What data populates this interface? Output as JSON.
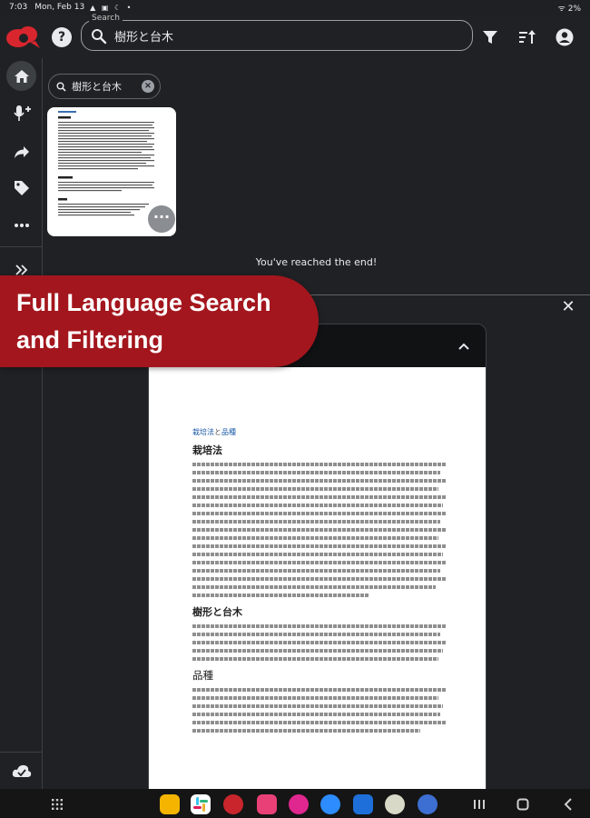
{
  "status_bar": {
    "time": "7:03",
    "date": "Mon, Feb 13",
    "notifications": "▲ ▣ ☾ •",
    "right": "ᯤ 2%"
  },
  "top_bar": {
    "search_legend": "Search",
    "search_query": "樹形と台木",
    "icons": [
      "logo",
      "help-icon",
      "search-icon",
      "filter-icon",
      "sort-icon",
      "account-icon"
    ]
  },
  "left_rail": {
    "items": [
      "home-icon",
      "voice-add-icon",
      "share-icon",
      "tag-icon",
      "more-icon",
      "expand-icon",
      "cloud-sync-icon"
    ]
  },
  "results": {
    "chip_label": "樹形と台木",
    "end_message": "You've reached the end!"
  },
  "promo": {
    "line1": "Full Language Search",
    "line2": "and Filtering"
  },
  "document": {
    "breadcrumb_a": "栽培法",
    "breadcrumb_sep": "と",
    "breadcrumb_b": "品種",
    "heading1": "栽培法",
    "heading2": "樹形と台木",
    "heading3": "品種"
  },
  "nav_bar": {
    "apps": [
      "files-app",
      "slack-app",
      "keep-app",
      "pink-app",
      "flower-app",
      "zoom-app",
      "swiftkey-app",
      "tree-app",
      "settings-app"
    ],
    "colors": {
      "files": "#f4b400",
      "slack": "#ffffff",
      "keep": "#c8262c",
      "pink": "#e94078",
      "flower": "#e0268f",
      "zoom": "#2d8cff",
      "swiftkey": "#1e6fd9",
      "tree": "#d9d9c8",
      "settings": "#3c6fd1"
    }
  },
  "colors": {
    "background": "#202124",
    "promo": "#a3161d",
    "accent_link": "#1a5aa6"
  }
}
